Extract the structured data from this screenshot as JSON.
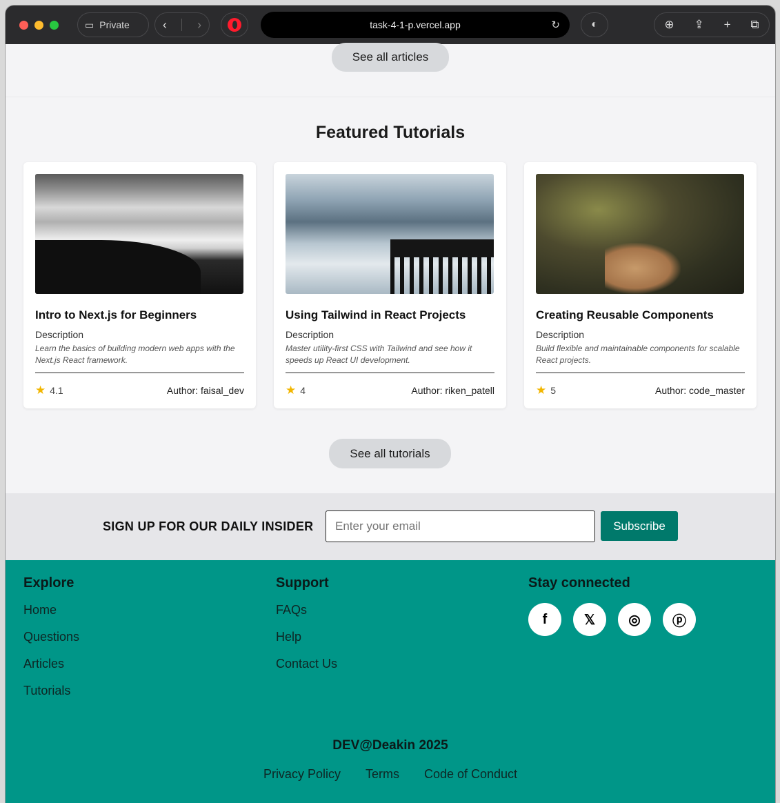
{
  "browser": {
    "private_label": "Private",
    "url": "task-4-1-p.vercel.app",
    "icons": [
      "sidebar-icon",
      "back-icon",
      "forward-icon",
      "opera-icon",
      "reload-icon",
      "shield-icon",
      "download-icon",
      "share-icon",
      "new-tab-icon",
      "tabs-icon"
    ]
  },
  "articles": {
    "see_all_label": "See all articles"
  },
  "tutorials": {
    "title": "Featured Tutorials",
    "see_all_label": "See all tutorials",
    "cards": [
      {
        "title": "Intro to Next.js for Beginners",
        "subtitle": "Description",
        "description": "Learn the basics of building modern web apps with the Next.js React framework.",
        "rating": "4.1",
        "author": "Author: faisal_dev"
      },
      {
        "title": "Using Tailwind in React Projects",
        "subtitle": "Description",
        "description": "Master utility-first CSS with Tailwind and see how it speeds up React UI development.",
        "rating": "4",
        "author": "Author: riken_patell"
      },
      {
        "title": "Creating Reusable Components",
        "subtitle": "Description",
        "description": "Build flexible and maintainable components for scalable React projects.",
        "rating": "5",
        "author": "Author: code_master"
      }
    ]
  },
  "newsletter": {
    "label": "SIGN UP FOR OUR DAILY INSIDER",
    "placeholder": "Enter your email",
    "button": "Subscribe"
  },
  "footer": {
    "explore": {
      "heading": "Explore",
      "links": [
        "Home",
        "Questions",
        "Articles",
        "Tutorials"
      ]
    },
    "support": {
      "heading": "Support",
      "links": [
        "FAQs",
        "Help",
        "Contact Us"
      ]
    },
    "social": {
      "heading": "Stay connected",
      "icons": [
        "facebook-icon",
        "twitter-icon",
        "instagram-icon",
        "pinterest-icon"
      ]
    },
    "copyright": "DEV@Deakin 2025",
    "legal": [
      "Privacy Policy",
      "Terms",
      "Code of Conduct"
    ]
  },
  "colors": {
    "accent": "#009688",
    "button": "#00796b",
    "star": "#f2b600"
  }
}
